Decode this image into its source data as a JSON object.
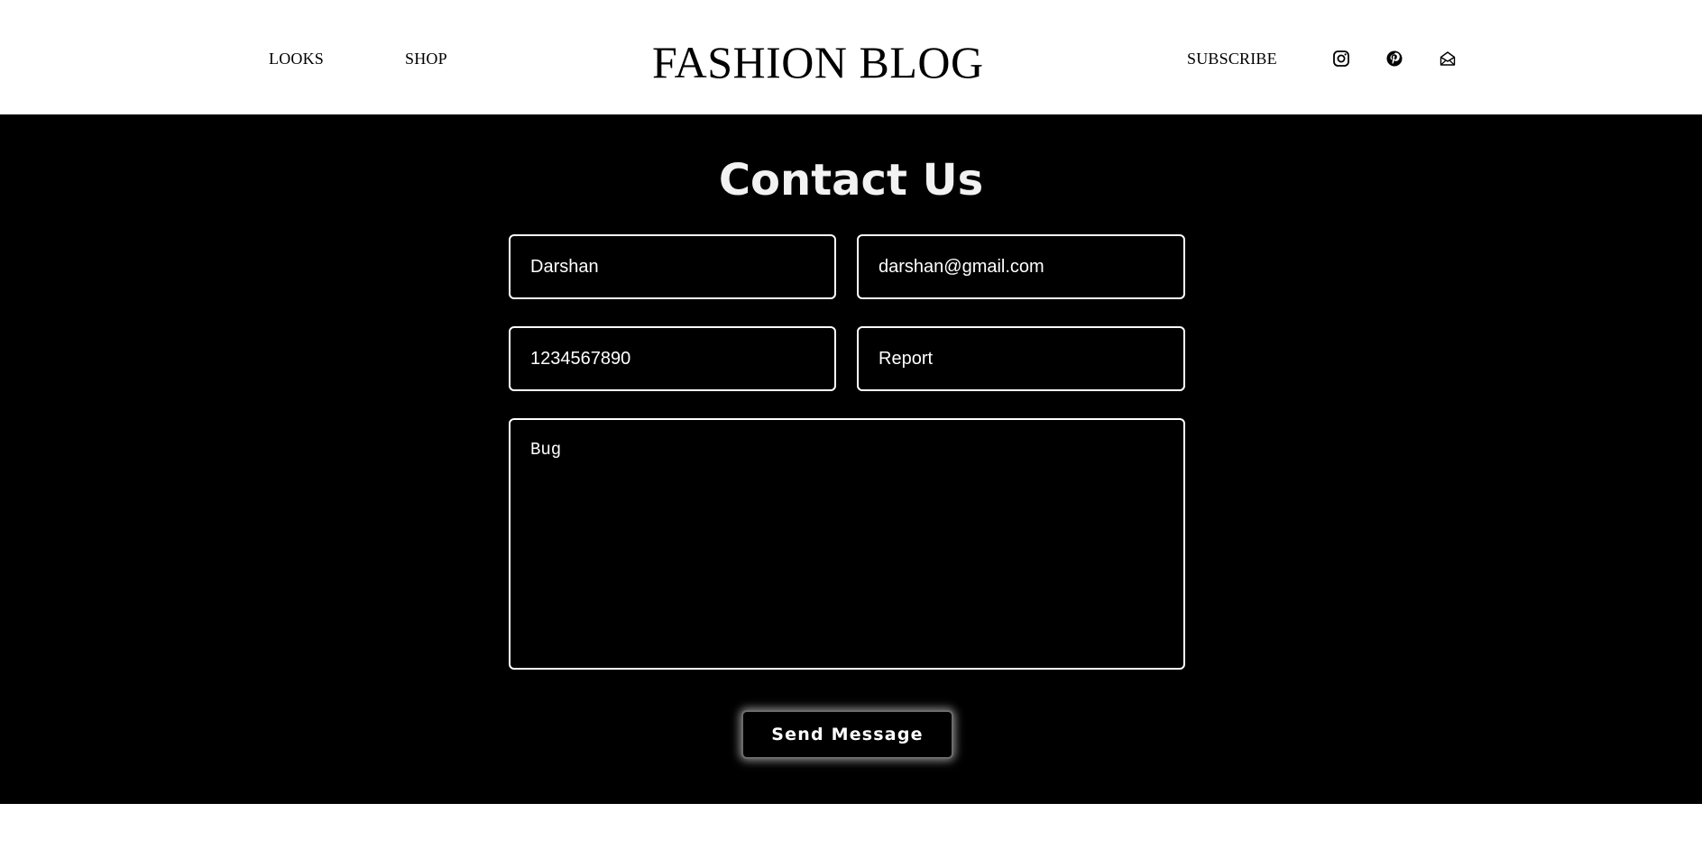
{
  "header": {
    "nav_left": [
      "LOOKS",
      "SHOP"
    ],
    "brand": "FASHION BLOG",
    "nav_right": "SUBSCRIBE",
    "icons": [
      "instagram-icon",
      "pinterest-icon",
      "mail-icon"
    ]
  },
  "contact": {
    "title": "Contact Us",
    "name_value": "Darshan",
    "email_value": "darshan@gmail.com",
    "phone_value": "1234567890",
    "subject_value": "Report",
    "message_value": "Bug",
    "send_label": "Send Message"
  },
  "colors": {
    "header_bg": "#ffffff",
    "contact_bg": "#000000",
    "text_light": "#ffffff"
  }
}
